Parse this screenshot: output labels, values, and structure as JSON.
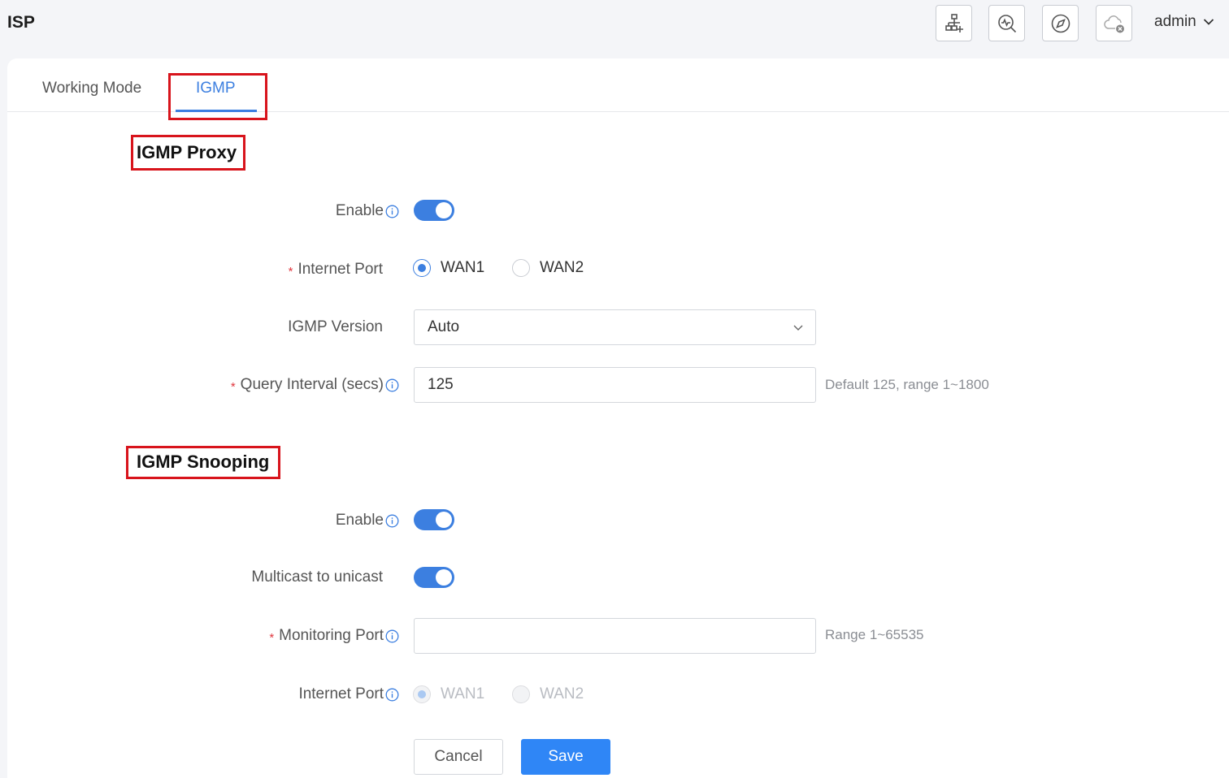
{
  "header": {
    "title": "ISP",
    "user": "admin",
    "icons": [
      "network-topology-icon",
      "diagnostics-icon",
      "compass-icon",
      "cloud-disconnected-icon"
    ]
  },
  "tabs": [
    {
      "label": "Working Mode",
      "active": false
    },
    {
      "label": "IGMP",
      "active": true
    }
  ],
  "igmp_proxy": {
    "title": "IGMP Proxy",
    "enable_label": "Enable",
    "enabled": true,
    "internet_port_label": "Internet Port",
    "ports": [
      "WAN1",
      "WAN2"
    ],
    "selected_port": "WAN1",
    "version_label": "IGMP Version",
    "version_value": "Auto",
    "query_interval_label": "Query Interval (secs)",
    "query_interval_value": "125",
    "query_interval_hint": "Default 125, range 1~1800"
  },
  "igmp_snooping": {
    "title": "IGMP Snooping",
    "enable_label": "Enable",
    "enabled": true,
    "multicast_label": "Multicast to unicast",
    "multicast_enabled": true,
    "monitoring_port_label": "Monitoring Port",
    "monitoring_port_value": "",
    "monitoring_port_hint": "Range 1~65535",
    "internet_port_label": "Internet Port",
    "ports": [
      "WAN1",
      "WAN2"
    ],
    "selected_port": "WAN1",
    "ports_disabled": true
  },
  "actions": {
    "cancel": "Cancel",
    "save": "Save"
  },
  "colors": {
    "accent": "#3c7fe0",
    "save_button": "#2f86f6",
    "required": "#e0373e",
    "highlight_box": "#d8141c"
  }
}
